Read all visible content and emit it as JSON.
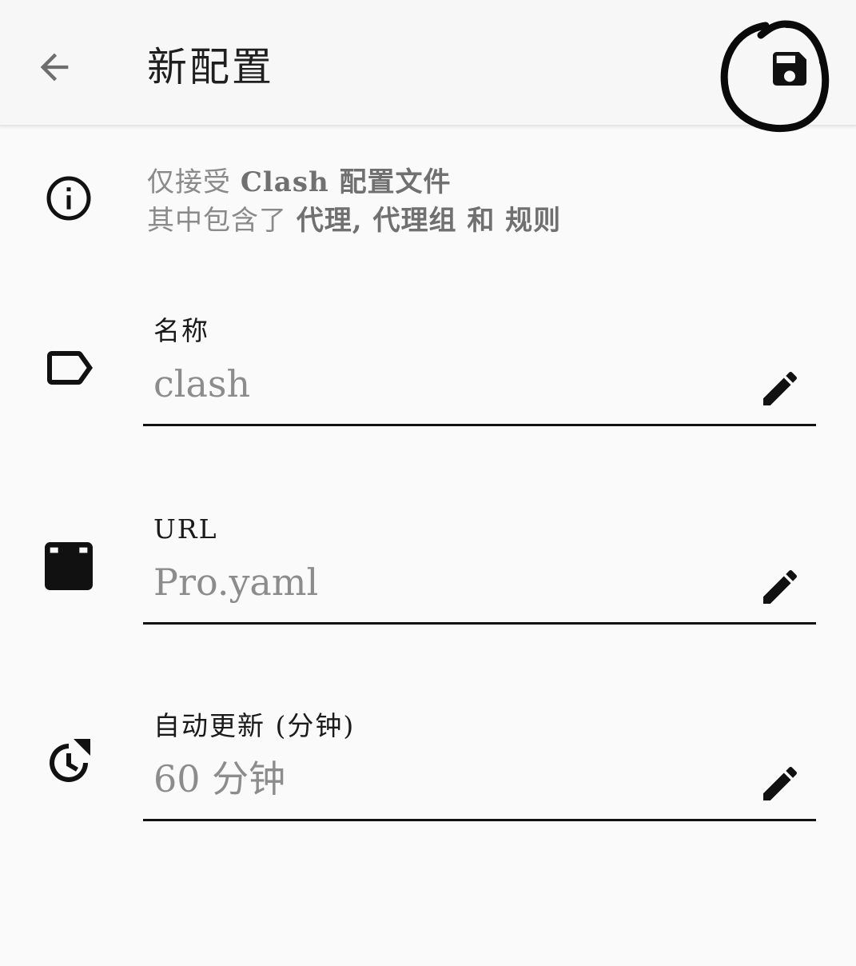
{
  "appbar": {
    "title": "新配置",
    "back_icon": "arrow-left-icon",
    "save_icon": "floppy-disk-icon"
  },
  "info": {
    "icon": "info-circle-icon",
    "line1_prefix": "仅接受",
    "line1_bold": "Clash 配置文件",
    "line2_prefix": "其中包含了",
    "line2_bold": "代理, 代理组 和 规则"
  },
  "fields": [
    {
      "label": "名称",
      "value": "clash",
      "icon": "label-tag-icon"
    },
    {
      "label": "URL",
      "value": "Pro.yaml",
      "icon": "download-box-icon"
    },
    {
      "label": "自动更新 (分钟)",
      "value": "60 分钟",
      "icon": "clock-refresh-icon"
    }
  ],
  "colors": {
    "background": "#fafafa",
    "label_text": "#1a1a1a",
    "value_text": "#8c8c8c",
    "hint_text": "#8a8a8a",
    "underline": "#111111"
  }
}
